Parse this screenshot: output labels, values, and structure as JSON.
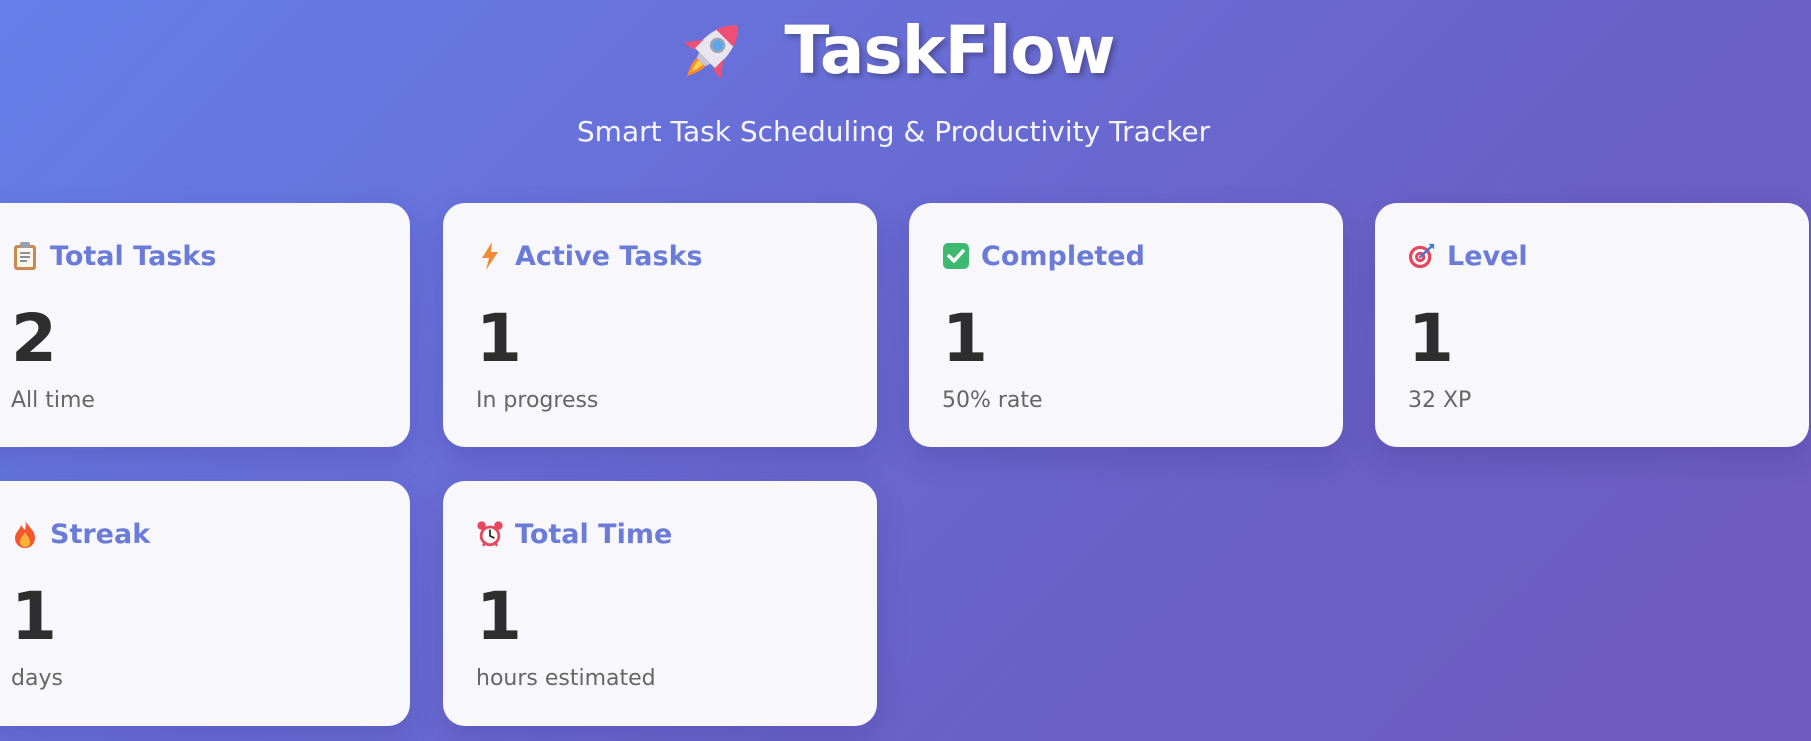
{
  "header": {
    "icon": "rocket-icon",
    "title": "TaskFlow",
    "subtitle": "Smart Task Scheduling & Productivity Tracker"
  },
  "colors": {
    "background_start": "#667eea",
    "background_end": "#6f5bbf",
    "card_background": "#f8f8fc",
    "card_title": "#6a7bd8",
    "value_text": "#2e2e2e",
    "sub_text": "#666666"
  },
  "stats": [
    {
      "id": "total-tasks",
      "icon": "clipboard-icon",
      "title": "Total Tasks",
      "value": "2",
      "sub": "All time"
    },
    {
      "id": "active-tasks",
      "icon": "lightning-icon",
      "title": "Active Tasks",
      "value": "1",
      "sub": "In progress"
    },
    {
      "id": "completed",
      "icon": "check-mark-icon",
      "title": "Completed",
      "value": "1",
      "sub": "50% rate"
    },
    {
      "id": "level",
      "icon": "target-icon",
      "title": "Level",
      "value": "1",
      "sub": "32 XP"
    },
    {
      "id": "streak",
      "icon": "fire-icon",
      "title": "Streak",
      "value": "1",
      "sub": "days"
    },
    {
      "id": "total-time",
      "icon": "alarm-clock-icon",
      "title": "Total Time",
      "value": "1",
      "sub": "hours estimated"
    }
  ]
}
